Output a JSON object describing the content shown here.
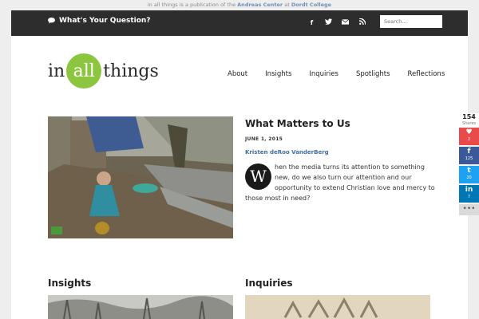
{
  "topline": {
    "prefix": "in all things is a publication of the",
    "center": "Andreas Center",
    "at": "at",
    "college": "Dordt College"
  },
  "topbar": {
    "question": "What's Your Question?",
    "search_placeholder": "Search..."
  },
  "logo": {
    "left": "in",
    "mid": "all",
    "right": "things"
  },
  "nav": [
    "About",
    "Insights",
    "Inquiries",
    "Spotlights",
    "Reflections"
  ],
  "feature": {
    "title": "What Matters to Us",
    "date": "JUNE 1, 2015",
    "author": "Kristen deRoo VanderBerg",
    "dropcap": "W",
    "excerpt": "hen the media turns its attention to something new, do we also turn our attention and our opportunity to extend Christian love and mercy to those most in need?"
  },
  "sections": [
    "Insights",
    "Inquiries"
  ],
  "share": {
    "total": "154",
    "total_label": "Shares",
    "buttons": [
      {
        "icon": "♥",
        "count": "2",
        "color": "#e94b4b"
      },
      {
        "icon": "f",
        "count": "125",
        "color": "#3b5998"
      },
      {
        "icon": "t",
        "count": "20",
        "color": "#1da1f2"
      },
      {
        "icon": "in",
        "count": "7",
        "color": "#0077b5"
      }
    ],
    "more": "•••"
  }
}
